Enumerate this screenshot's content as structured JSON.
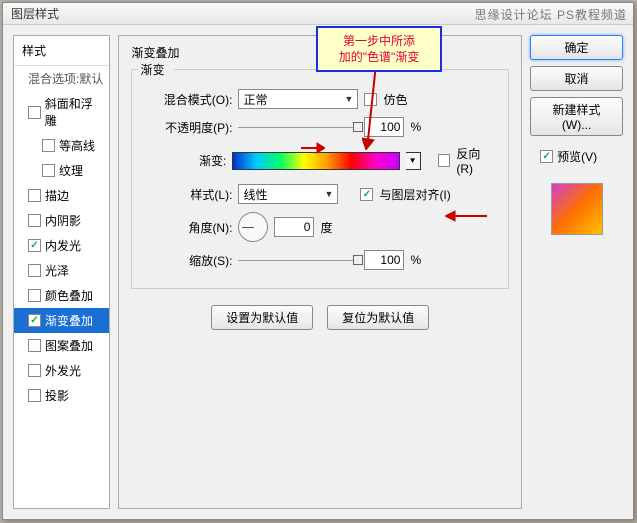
{
  "watermark": "思缘设计论坛  PS教程频道",
  "dialog": {
    "title": "图层样式"
  },
  "sidebar": {
    "header": "样式",
    "blend_default": "混合选项:默认",
    "items": [
      {
        "label": "斜面和浮雕",
        "checked": false,
        "selected": false,
        "nested": false
      },
      {
        "label": "等高线",
        "checked": false,
        "selected": false,
        "nested": true
      },
      {
        "label": "纹理",
        "checked": false,
        "selected": false,
        "nested": true
      },
      {
        "label": "描边",
        "checked": false,
        "selected": false,
        "nested": false
      },
      {
        "label": "内阴影",
        "checked": false,
        "selected": false,
        "nested": false
      },
      {
        "label": "内发光",
        "checked": true,
        "selected": false,
        "nested": false
      },
      {
        "label": "光泽",
        "checked": false,
        "selected": false,
        "nested": false
      },
      {
        "label": "颜色叠加",
        "checked": false,
        "selected": false,
        "nested": false
      },
      {
        "label": "渐变叠加",
        "checked": true,
        "selected": true,
        "nested": false
      },
      {
        "label": "图案叠加",
        "checked": false,
        "selected": false,
        "nested": false
      },
      {
        "label": "外发光",
        "checked": false,
        "selected": false,
        "nested": false
      },
      {
        "label": "投影",
        "checked": false,
        "selected": false,
        "nested": false
      }
    ]
  },
  "main": {
    "section_title": "渐变叠加",
    "fieldset_legend": "渐变",
    "blend_label": "混合模式(O):",
    "blend_value": "正常",
    "dither_label": "仿色",
    "opacity_label": "不透明度(P):",
    "opacity_value": "100",
    "percent": "%",
    "gradient_label": "渐变:",
    "reverse_label": "反向(R)",
    "style_label": "样式(L):",
    "style_value": "线性",
    "align_label": "与图层对齐(I)",
    "align_checked": true,
    "angle_label": "角度(N):",
    "angle_value": "0",
    "angle_unit": "度",
    "scale_label": "缩放(S):",
    "scale_value": "100",
    "set_default": "设置为默认值",
    "reset_default": "复位为默认值"
  },
  "right": {
    "ok": "确定",
    "cancel": "取消",
    "new_style": "新建样式(W)...",
    "preview_label": "预览(V)"
  },
  "callout": {
    "line1": "第一步中所添",
    "line2": "加的\"色谱\"渐变"
  }
}
